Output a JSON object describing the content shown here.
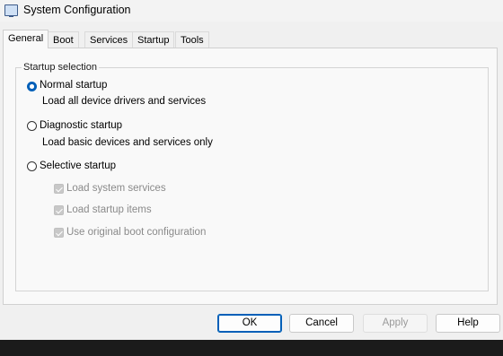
{
  "window": {
    "title": "System Configuration"
  },
  "tabs": [
    {
      "label": "General",
      "active": true
    },
    {
      "label": "Boot",
      "active": false
    },
    {
      "label": "Services",
      "active": false
    },
    {
      "label": "Startup",
      "active": false
    },
    {
      "label": "Tools",
      "active": false
    }
  ],
  "startup_selection": {
    "group_label": "Startup selection",
    "options": [
      {
        "label": "Normal startup",
        "description": "Load all device drivers and services",
        "selected": true
      },
      {
        "label": "Diagnostic startup",
        "description": "Load basic devices and services only",
        "selected": false
      },
      {
        "label": "Selective startup",
        "selected": false
      }
    ],
    "selective_items": [
      {
        "label": "Load system services",
        "checked": true,
        "enabled": false
      },
      {
        "label": "Load startup items",
        "checked": true,
        "enabled": false
      },
      {
        "label": "Use original boot configuration",
        "checked": true,
        "enabled": false
      }
    ]
  },
  "buttons": {
    "ok": "OK",
    "cancel": "Cancel",
    "apply": "Apply",
    "help": "Help"
  },
  "colors": {
    "accent": "#005fb8",
    "disabled_text": "#8a8a8a"
  }
}
